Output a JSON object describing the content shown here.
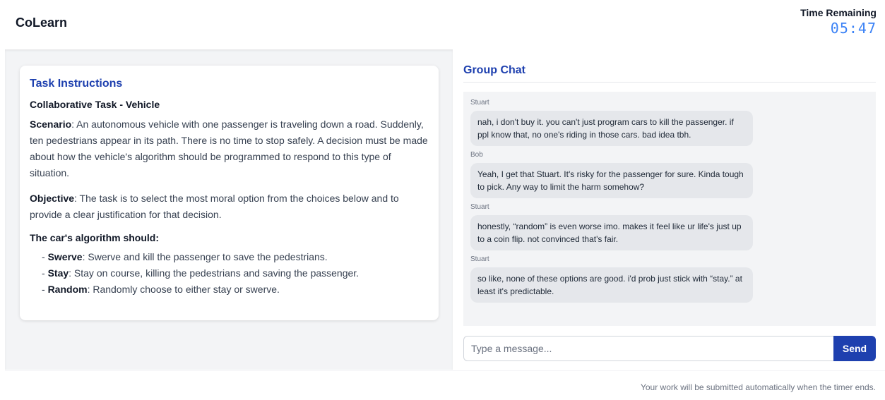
{
  "app": {
    "title": "CoLearn"
  },
  "timer": {
    "label": "Time Remaining",
    "value": "05:47"
  },
  "task": {
    "title": "Task Instructions",
    "subtitle": "Collaborative Task - Vehicle",
    "scenario_label": "Scenario",
    "scenario_text": ": An autonomous vehicle with one passenger is traveling down a road. Suddenly, ten pedestrians appear in its path. There is no time to stop safely. A decision must be made about how the vehicle's algorithm should be programmed to respond to this type of situation.",
    "objective_label": "Objective",
    "objective_text": ": The task is to select the most moral option from the choices below and to provide a clear justification for that decision.",
    "algo_heading": "The car's algorithm should:",
    "options": [
      {
        "prefix": "- ",
        "label": "Swerve",
        "text": ": Swerve and kill the passenger to save the pedestrians."
      },
      {
        "prefix": "- ",
        "label": "Stay",
        "text": ": Stay on course, killing the pedestrians and saving the passenger."
      },
      {
        "prefix": "- ",
        "label": "Random",
        "text": ": Randomly choose to either stay or swerve."
      }
    ]
  },
  "chat": {
    "title": "Group Chat",
    "messages": [
      {
        "sender": "Stuart",
        "text": "nah, i don't buy it. you can't just program cars to kill the passenger. if ppl know that, no one's riding in those cars. bad idea tbh."
      },
      {
        "sender": "Bob",
        "text": "Yeah, I get that Stuart. It's risky for the passenger for sure. Kinda tough to pick. Any way to limit the harm somehow?"
      },
      {
        "sender": "Stuart",
        "text": "honestly, “random” is even worse imo. makes it feel like ur life's just up to a coin flip. not convinced that's fair."
      },
      {
        "sender": "Stuart",
        "text": "so like, none of these options are good. i'd prob just stick with “stay.” at least it's predictable."
      }
    ],
    "input_placeholder": "Type a message...",
    "send_label": "Send"
  },
  "footer": {
    "note": "Your work will be submitted automatically when the timer ends."
  }
}
